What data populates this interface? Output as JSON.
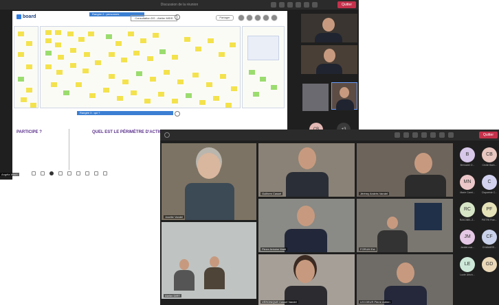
{
  "back_window": {
    "title": "Discussion de la réunion",
    "leave_label": "Quitter",
    "board": {
      "logo": "board",
      "tab_top": "Rangée 2 : personnes",
      "tab_bottom": "Rangée 3 : qui ?",
      "consultation_label": "Consultation DG - Atelier MIDD",
      "share_button": "Partager",
      "label_participe": "PARTICIPE ?",
      "label_perimetre": "QUEL EST LE PÉRIMÈTRE D'ACTION"
    },
    "presenter_name": "Angéla Wach",
    "badges": {
      "cb": "CB",
      "more": "+3"
    }
  },
  "front_window": {
    "leave_label": "Quitter",
    "tiles": [
      {
        "name": "Josette Vandel"
      },
      {
        "name": "Guilhem Cassel"
      },
      {
        "name": "Jérémy Andrès Vandel"
      },
      {
        "name": "Pierre Antoine Marti"
      },
      {
        "name": "FORUM Est"
      },
      {
        "name": "Atelier DIRT"
      },
      {
        "name": "VÉRONIQUE Cassel Vandel"
      },
      {
        "name": "LECOEUR Pierre Adrien"
      }
    ],
    "roster": [
      {
        "initials": "B",
        "name": "Bernadet O...",
        "color": "#d7c7e8"
      },
      {
        "initials": "CB",
        "name": "Cécile Barb...",
        "color": "#e8c7c0"
      },
      {
        "initials": "MN",
        "name": "Marie Caret...",
        "color": "#ecc7c9"
      },
      {
        "initials": "C",
        "name": "Claparède C...",
        "color": "#d2d2ef"
      },
      {
        "initials": "RC",
        "name": "RAKOBEL Z...",
        "color": "#d6e5c6"
      },
      {
        "initials": "PF",
        "name": "PIETRI Fran...",
        "color": "#e6e2b8"
      },
      {
        "initials": "JM",
        "name": "Jardiet mar...",
        "color": "#e5c8e5"
      },
      {
        "initials": "CF",
        "name": "CHAMARE...",
        "color": "#c9d2ea"
      },
      {
        "initials": "LE",
        "name": "Lucie Ulrich...",
        "color": "#cde8d8"
      },
      {
        "initials": "GD",
        "name": "",
        "color": "#ead8b8"
      }
    ]
  }
}
